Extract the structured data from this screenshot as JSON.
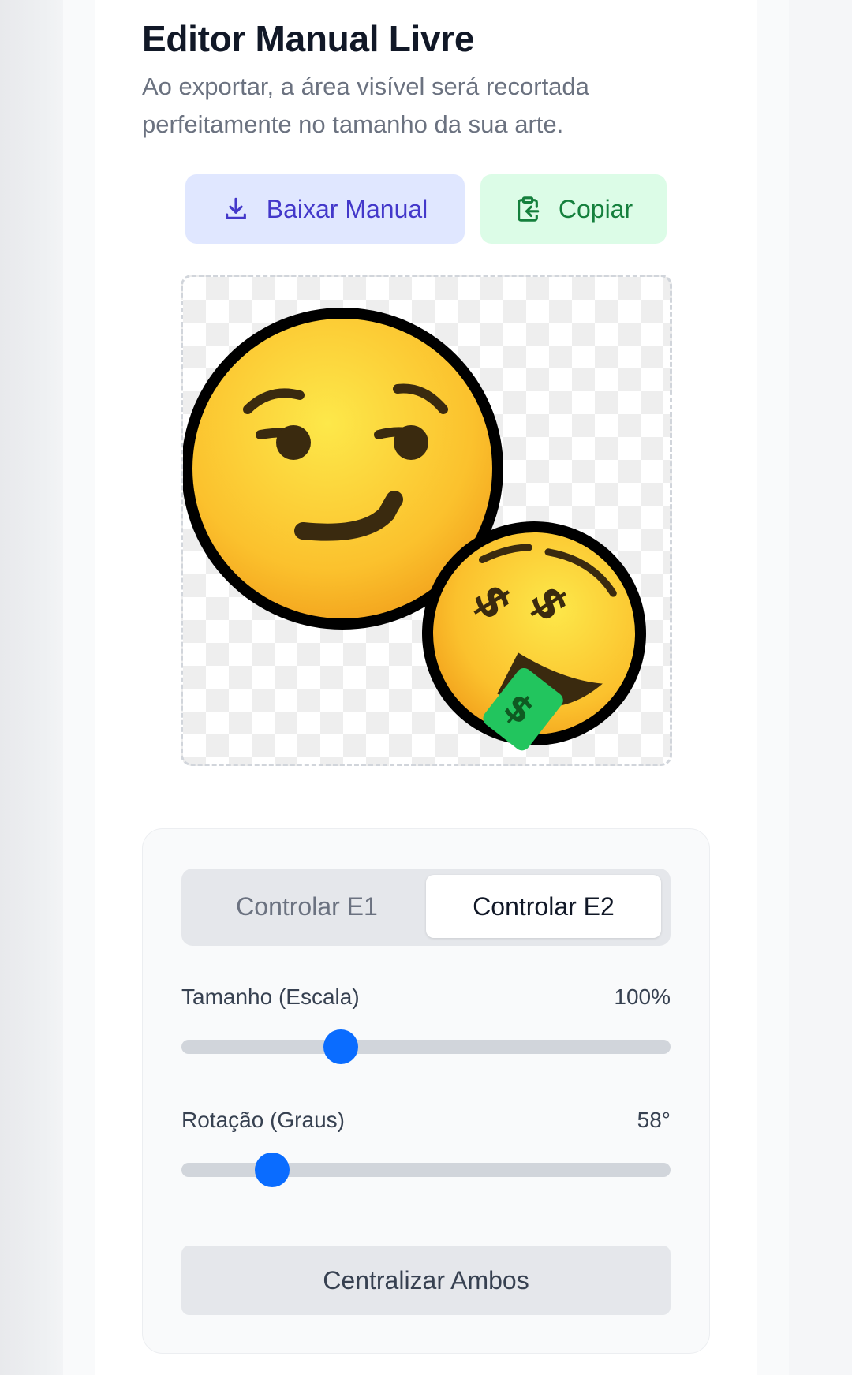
{
  "header": {
    "title": "Editor Manual Livre",
    "subtitle": "Ao exportar, a área visível será recortada perfeitamente no tamanho da sua arte."
  },
  "actions": {
    "download_label": "Baixar Manual",
    "download_icon": "download-icon",
    "copy_label": "Copiar",
    "copy_icon": "clipboard-copy-icon"
  },
  "canvas": {
    "emoji_1": "smirking-face-emoji",
    "emoji_2": "money-mouth-face-emoji"
  },
  "controls": {
    "tabs": [
      {
        "label": "Controlar E1",
        "active": false
      },
      {
        "label": "Controlar E2",
        "active": true
      }
    ],
    "scale": {
      "label": "Tamanho (Escala)",
      "value_text": "100%",
      "slider_fraction": 0.325
    },
    "rotation": {
      "label": "Rotação (Graus)",
      "value_text": "58°",
      "slider_fraction": 0.186
    },
    "center_label": "Centralizar Ambos"
  },
  "colors": {
    "accent": "#0a6cff",
    "download_bg": "#e0e7ff",
    "download_fg": "#4338ca",
    "copy_bg": "#dcfce7",
    "copy_fg": "#15803d"
  }
}
